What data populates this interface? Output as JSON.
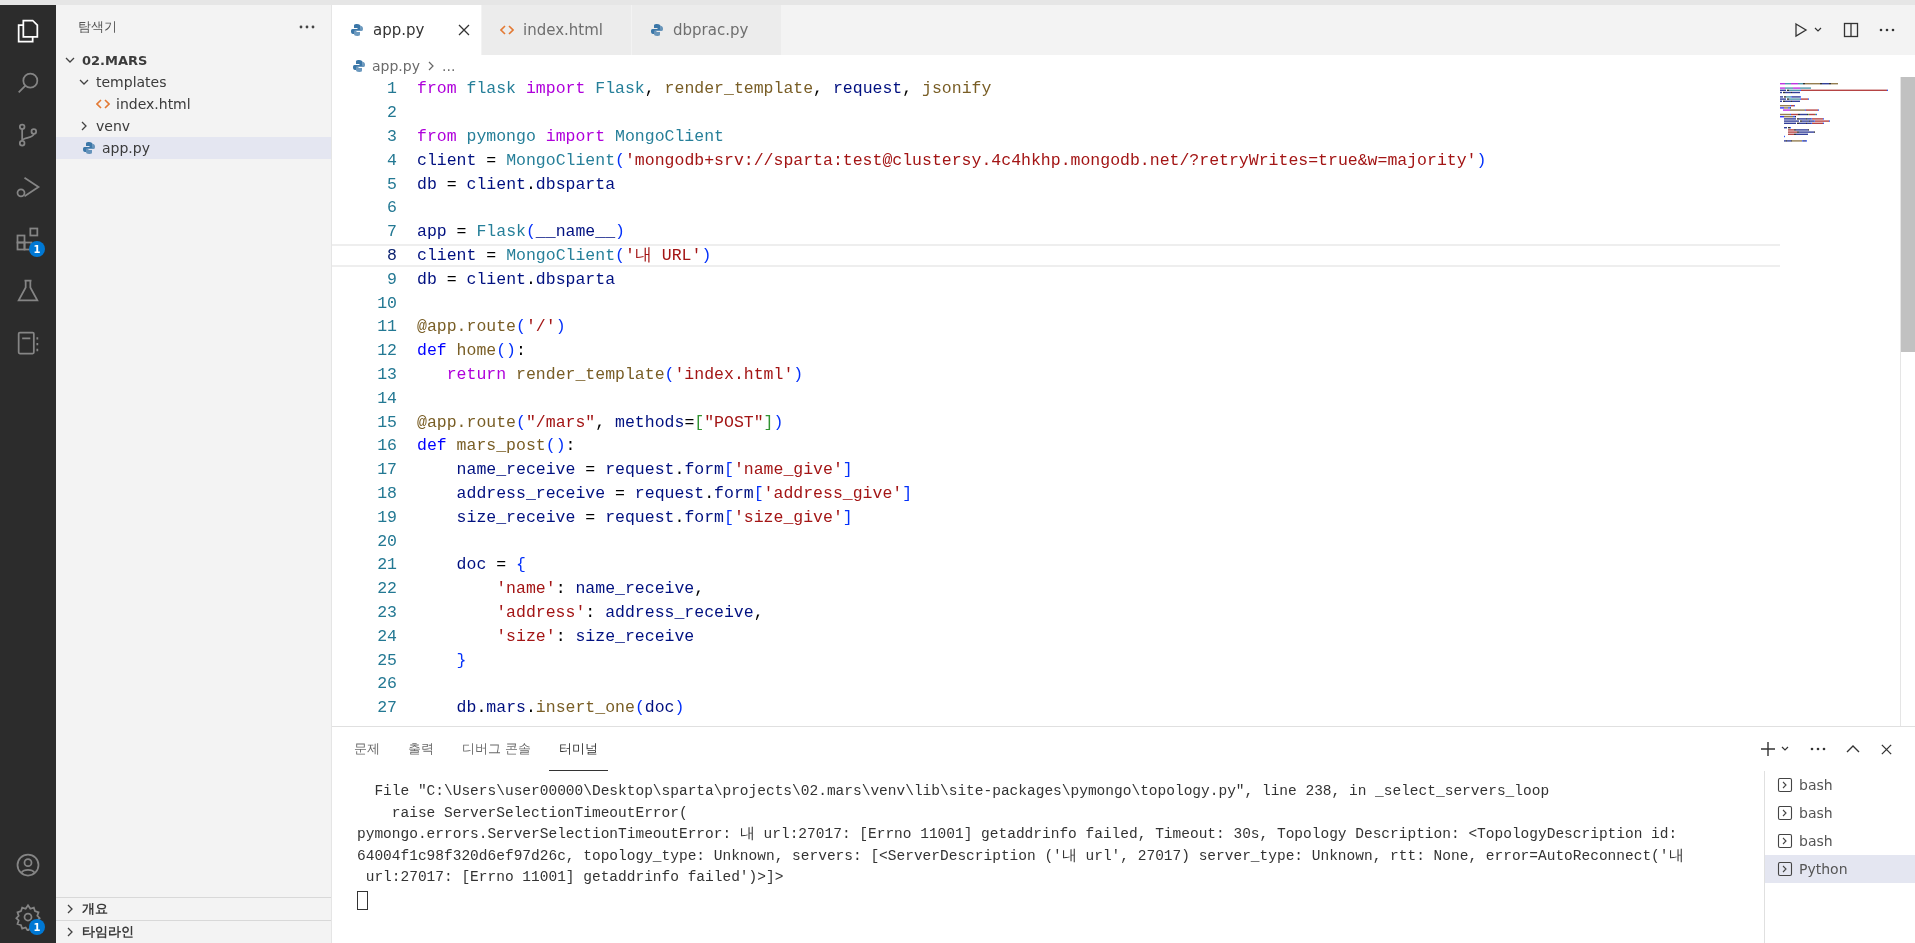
{
  "activity_bar": {
    "top": [
      {
        "selected": true
      },
      {
        "selected": false
      },
      {
        "selected": false
      },
      {
        "selected": false
      },
      {
        "selected": false,
        "badge": "1"
      },
      {
        "selected": false
      },
      {
        "selected": false
      }
    ],
    "bottom": [
      {
        "selected": false
      },
      {
        "selected": false,
        "badge": "1"
      }
    ]
  },
  "sidebar": {
    "title": "탐색기",
    "tree": [
      {
        "label": "02.MARS",
        "kind": "root",
        "expanded": true,
        "selected": false,
        "children": [
          {
            "label": "templates",
            "kind": "folder",
            "expanded": true,
            "selected": false,
            "children": [
              {
                "label": "index.html",
                "kind": "html",
                "selected": false
              }
            ]
          },
          {
            "label": "venv",
            "kind": "folder",
            "expanded": false,
            "selected": false
          },
          {
            "label": "app.py",
            "kind": "python",
            "selected": true
          }
        ]
      }
    ],
    "sections": [
      {
        "label": "개요",
        "expanded": false
      },
      {
        "label": "타임라인",
        "expanded": false
      }
    ]
  },
  "tabs": [
    {
      "label": "app.py",
      "kind": "python",
      "selected": true
    },
    {
      "label": "index.html",
      "kind": "html",
      "selected": false
    },
    {
      "label": "dbprac.py",
      "kind": "python",
      "selected": false
    }
  ],
  "breadcrumb": {
    "file": "app.py",
    "kind": "python",
    "rest": "..."
  },
  "editor": {
    "lines": [
      {
        "number": "1",
        "current": false,
        "tokens": [
          {
            "text": "from ",
            "kind": "kw"
          },
          {
            "text": "flask ",
            "kind": "cls"
          },
          {
            "text": "import ",
            "kind": "kw"
          },
          {
            "text": "Flask",
            "kind": "cls"
          },
          {
            "text": ", ",
            "kind": "p"
          },
          {
            "text": "render_template",
            "kind": "fn"
          },
          {
            "text": ", ",
            "kind": "p"
          },
          {
            "text": "request",
            "kind": "var"
          },
          {
            "text": ", ",
            "kind": "p"
          },
          {
            "text": "jsonify",
            "kind": "fn"
          }
        ]
      },
      {
        "number": "2",
        "current": false
      },
      {
        "number": "3",
        "current": false,
        "tokens": [
          {
            "text": "from ",
            "kind": "kw"
          },
          {
            "text": "pymongo ",
            "kind": "cls"
          },
          {
            "text": "import ",
            "kind": "kw"
          },
          {
            "text": "MongoClient",
            "kind": "cls"
          }
        ]
      },
      {
        "number": "4",
        "current": false,
        "tokens": [
          {
            "text": "client",
            "kind": "var"
          },
          {
            "text": " = ",
            "kind": "p"
          },
          {
            "text": "MongoClient",
            "kind": "cls"
          },
          {
            "text": "(",
            "kind": "b1"
          },
          {
            "text": "'mongodb+srv://sparta:test@clustersy.4c4hkhp.mongodb.net/?retryWrites=true&w=majority'",
            "kind": "str"
          },
          {
            "text": ")",
            "kind": "b1"
          }
        ]
      },
      {
        "number": "5",
        "current": false,
        "tokens": [
          {
            "text": "db",
            "kind": "var"
          },
          {
            "text": " = ",
            "kind": "p"
          },
          {
            "text": "client",
            "kind": "var"
          },
          {
            "text": ".",
            "kind": "p"
          },
          {
            "text": "dbsparta",
            "kind": "var"
          }
        ]
      },
      {
        "number": "6",
        "current": false
      },
      {
        "number": "7",
        "current": false,
        "tokens": [
          {
            "text": "app",
            "kind": "var"
          },
          {
            "text": " = ",
            "kind": "p"
          },
          {
            "text": "Flask",
            "kind": "cls"
          },
          {
            "text": "(",
            "kind": "b1"
          },
          {
            "text": "__name__",
            "kind": "var"
          },
          {
            "text": ")",
            "kind": "b1"
          }
        ]
      },
      {
        "number": "8",
        "current": true,
        "tokens": [
          {
            "text": "client",
            "kind": "var"
          },
          {
            "text": " = ",
            "kind": "p"
          },
          {
            "text": "MongoClient",
            "kind": "cls"
          },
          {
            "text": "(",
            "kind": "b1"
          },
          {
            "text": "'내 URL'",
            "kind": "str"
          },
          {
            "text": ")",
            "kind": "b1"
          }
        ]
      },
      {
        "number": "9",
        "current": false,
        "tokens": [
          {
            "text": "db",
            "kind": "var"
          },
          {
            "text": " = ",
            "kind": "p"
          },
          {
            "text": "client",
            "kind": "var"
          },
          {
            "text": ".",
            "kind": "p"
          },
          {
            "text": "dbsparta",
            "kind": "var"
          }
        ]
      },
      {
        "number": "10",
        "current": false
      },
      {
        "number": "11",
        "current": false,
        "tokens": [
          {
            "text": "@app.route",
            "kind": "fn"
          },
          {
            "text": "(",
            "kind": "b1"
          },
          {
            "text": "'/'",
            "kind": "str"
          },
          {
            "text": ")",
            "kind": "b1"
          }
        ]
      },
      {
        "number": "12",
        "current": false,
        "tokens": [
          {
            "text": "def ",
            "kind": "kw2"
          },
          {
            "text": "home",
            "kind": "fn"
          },
          {
            "text": "()",
            "kind": "b1"
          },
          {
            "text": ":",
            "kind": "p"
          }
        ]
      },
      {
        "number": "13",
        "current": false,
        "tokens": [
          {
            "text": "   return ",
            "kind": "kw"
          },
          {
            "text": "render_template",
            "kind": "fn"
          },
          {
            "text": "(",
            "kind": "b1"
          },
          {
            "text": "'index.html'",
            "kind": "str"
          },
          {
            "text": ")",
            "kind": "b1"
          }
        ]
      },
      {
        "number": "14",
        "current": false
      },
      {
        "number": "15",
        "current": false,
        "tokens": [
          {
            "text": "@app.route",
            "kind": "fn"
          },
          {
            "text": "(",
            "kind": "b1"
          },
          {
            "text": "\"/mars\"",
            "kind": "str"
          },
          {
            "text": ", ",
            "kind": "p"
          },
          {
            "text": "methods",
            "kind": "var"
          },
          {
            "text": "=",
            "kind": "p"
          },
          {
            "text": "[",
            "kind": "b2"
          },
          {
            "text": "\"POST\"",
            "kind": "str"
          },
          {
            "text": "]",
            "kind": "b2"
          },
          {
            "text": ")",
            "kind": "b1"
          }
        ]
      },
      {
        "number": "16",
        "current": false,
        "tokens": [
          {
            "text": "def ",
            "kind": "kw2"
          },
          {
            "text": "mars_post",
            "kind": "fn"
          },
          {
            "text": "()",
            "kind": "b1"
          },
          {
            "text": ":",
            "kind": "p"
          }
        ]
      },
      {
        "number": "17",
        "current": false,
        "tokens": [
          {
            "text": "    name_receive",
            "kind": "var"
          },
          {
            "text": " = ",
            "kind": "p"
          },
          {
            "text": "request",
            "kind": "var"
          },
          {
            "text": ".",
            "kind": "p"
          },
          {
            "text": "form",
            "kind": "var"
          },
          {
            "text": "[",
            "kind": "b1"
          },
          {
            "text": "'name_give'",
            "kind": "str"
          },
          {
            "text": "]",
            "kind": "b1"
          }
        ]
      },
      {
        "number": "18",
        "current": false,
        "tokens": [
          {
            "text": "    address_receive",
            "kind": "var"
          },
          {
            "text": " = ",
            "kind": "p"
          },
          {
            "text": "request",
            "kind": "var"
          },
          {
            "text": ".",
            "kind": "p"
          },
          {
            "text": "form",
            "kind": "var"
          },
          {
            "text": "[",
            "kind": "b1"
          },
          {
            "text": "'address_give'",
            "kind": "str"
          },
          {
            "text": "]",
            "kind": "b1"
          }
        ]
      },
      {
        "number": "19",
        "current": false,
        "tokens": [
          {
            "text": "    size_receive",
            "kind": "var"
          },
          {
            "text": " = ",
            "kind": "p"
          },
          {
            "text": "request",
            "kind": "var"
          },
          {
            "text": ".",
            "kind": "p"
          },
          {
            "text": "form",
            "kind": "var"
          },
          {
            "text": "[",
            "kind": "b1"
          },
          {
            "text": "'size_give'",
            "kind": "str"
          },
          {
            "text": "]",
            "kind": "b1"
          }
        ]
      },
      {
        "number": "20",
        "current": false
      },
      {
        "number": "21",
        "current": false,
        "tokens": [
          {
            "text": "    doc",
            "kind": "var"
          },
          {
            "text": " = ",
            "kind": "p"
          },
          {
            "text": "{",
            "kind": "b1"
          }
        ]
      },
      {
        "number": "22",
        "current": false,
        "tokens": [
          {
            "text": "        'name'",
            "kind": "str"
          },
          {
            "text": ": ",
            "kind": "p"
          },
          {
            "text": "name_receive",
            "kind": "var"
          },
          {
            "text": ",",
            "kind": "p"
          }
        ]
      },
      {
        "number": "23",
        "current": false,
        "tokens": [
          {
            "text": "        'address'",
            "kind": "str"
          },
          {
            "text": ": ",
            "kind": "p"
          },
          {
            "text": "address_receive",
            "kind": "var"
          },
          {
            "text": ",",
            "kind": "p"
          }
        ]
      },
      {
        "number": "24",
        "current": false,
        "tokens": [
          {
            "text": "        'size'",
            "kind": "str"
          },
          {
            "text": ": ",
            "kind": "p"
          },
          {
            "text": "size_receive",
            "kind": "var"
          }
        ]
      },
      {
        "number": "25",
        "current": false,
        "tokens": [
          {
            "text": "    }",
            "kind": "b1"
          }
        ]
      },
      {
        "number": "26",
        "current": false
      },
      {
        "number": "27",
        "current": false,
        "tokens": [
          {
            "text": "    db",
            "kind": "var"
          },
          {
            "text": ".",
            "kind": "p"
          },
          {
            "text": "mars",
            "kind": "var"
          },
          {
            "text": ".",
            "kind": "p"
          },
          {
            "text": "insert_one",
            "kind": "fn"
          },
          {
            "text": "(",
            "kind": "b1"
          },
          {
            "text": "doc",
            "kind": "var"
          },
          {
            "text": ")",
            "kind": "b1"
          }
        ]
      }
    ]
  },
  "panel": {
    "tabs": [
      {
        "label": "문제",
        "selected": false
      },
      {
        "label": "출력",
        "selected": false
      },
      {
        "label": "디버그 콘솔",
        "selected": false
      },
      {
        "label": "터미널",
        "selected": true
      }
    ],
    "terminal_lines": [
      "  File \"C:\\Users\\user00000\\Desktop\\sparta\\projects\\02.mars\\venv\\lib\\site-packages\\pymongo\\topology.py\", line 238, in _select_servers_loop",
      "    raise ServerSelectionTimeoutError(",
      "pymongo.errors.ServerSelectionTimeoutError: 내 url:27017: [Errno 11001] getaddrinfo failed, Timeout: 30s, Topology Description: <TopologyDescription id:",
      "64004f1c98f320d6ef97d26c, topology_type: Unknown, servers: [<ServerDescription ('내 url', 27017) server_type: Unknown, rtt: None, error=AutoReconnect('내",
      " url:27017: [Errno 11001] getaddrinfo failed')>]>"
    ],
    "terminals": [
      {
        "label": "bash",
        "selected": false
      },
      {
        "label": "bash",
        "selected": false
      },
      {
        "label": "bash",
        "selected": false
      },
      {
        "label": "Python",
        "selected": true
      }
    ]
  }
}
